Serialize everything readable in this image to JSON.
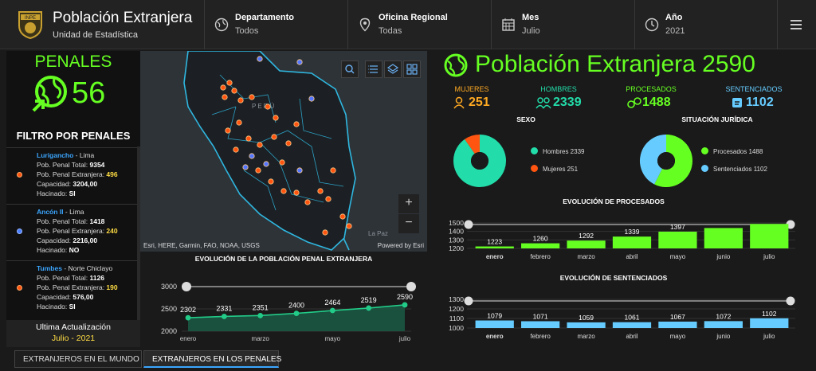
{
  "header": {
    "title": "Población Extranjera",
    "subtitle": "Unidad de Estadística",
    "logo_text": "INPE",
    "filters": [
      {
        "label": "Departamento",
        "value": "Todos",
        "icon": "globe-icon"
      },
      {
        "label": "Oficina Regional",
        "value": "Todas",
        "icon": "location-pin-icon"
      },
      {
        "label": "Mes",
        "value": "Julio",
        "icon": "calendar-icon"
      },
      {
        "label": "Año",
        "value": "2021",
        "icon": "clock-icon"
      }
    ],
    "menu_icon": "hamburger-menu-icon"
  },
  "left": {
    "penales_title": "PENALES",
    "penales_count": "56",
    "filtro_title": "FILTRO POR PENALES",
    "cards": [
      {
        "name": "Lurigancho",
        "region": " - Lima",
        "total_label": "Pob. Penal Total: ",
        "total": "9354",
        "ext_label": "Pob. Penal Extranjera: ",
        "ext": "496",
        "cap_label": "Capacidad: ",
        "cap": "3204,00",
        "hac_label": "Hacinado: ",
        "hac": "SI",
        "dot_color": "#ff5511"
      },
      {
        "name": "Ancón II",
        "region": " - Lima",
        "total_label": "Pob. Penal Total: ",
        "total": "1418",
        "ext_label": "Pob. Penal Extranjera: ",
        "ext": "240",
        "cap_label": "Capacidad: ",
        "cap": "2216,00",
        "hac_label": "Hacinado: ",
        "hac": "NO",
        "dot_color": "#4a7dff"
      },
      {
        "name": "Tumbes",
        "region": " - Norte Chiclayo",
        "total_label": "Pob. Penal Total: ",
        "total": "1126",
        "ext_label": "Pob. Penal Extranjera: ",
        "ext": "190",
        "cap_label": "Capacidad: ",
        "cap": "576,00",
        "hac_label": "Hacinado: ",
        "hac": "SI",
        "dot_color": "#ff5511"
      }
    ],
    "ultima_label": "Ultima Actualización",
    "ultima_value": "Julio - 2021"
  },
  "map": {
    "attribution": "Esri, HERE, Garmin, FAO, NOAA, USGS",
    "powered": "Powered by Esri",
    "country_label": "PERÚ",
    "city_label": "La Paz",
    "zoom_in": "+",
    "zoom_out": "−"
  },
  "evolucion_penal": {
    "title": "EVOLUCIÓN DE LA POBLACIÓN PENAL EXTRANJERA"
  },
  "right": {
    "title": "Población Extranjera 2590",
    "stats": [
      {
        "label": "MUJERES",
        "value": "251",
        "color": "#ffaa22",
        "icon": "woman-icon"
      },
      {
        "label": "HOMBRES",
        "value": "2339",
        "color": "#22ddaa",
        "icon": "men-group-icon"
      },
      {
        "label": "PROCESADOS",
        "value": "1488",
        "color": "#66ff22",
        "icon": "handcuffs-icon"
      },
      {
        "label": "SENTENCIADOS",
        "value": "1102",
        "color": "#66ccff",
        "icon": "gavel-icon"
      }
    ],
    "sexo_title": "SEXO",
    "situacion_title": "SITUACIÓN JURÍDICA",
    "sexo_legend": [
      {
        "label": "Hombres 2339",
        "color": "#22ddaa"
      },
      {
        "label": "Mujeres 251",
        "color": "#ff5511"
      }
    ],
    "situacion_legend": [
      {
        "label": "Procesados 1488",
        "color": "#66ff22"
      },
      {
        "label": "Sentenciados 1102",
        "color": "#66ccff"
      }
    ],
    "procesados_title": "EVOLUCIÓN DE PROCESADOS",
    "sentenciados_title": "EVOLUCIÓN DE SENTENCIADOS"
  },
  "tabs": [
    {
      "label": "EXTRANJEROS EN EL MUNDO",
      "active": false
    },
    {
      "label": "EXTRANJEROS EN LOS PENALES",
      "active": true
    }
  ],
  "chart_data": [
    {
      "type": "area",
      "title": "EVOLUCIÓN DE LA POBLACIÓN PENAL EXTRANJERA",
      "x_tick_labels": [
        "enero",
        "marzo",
        "mayo",
        "julio"
      ],
      "values": [
        2302,
        2331,
        2351,
        2400,
        2464,
        2519,
        2590
      ],
      "y_ticks": [
        2000,
        2500,
        3000
      ],
      "ylim": [
        2000,
        3000
      ],
      "color": "#22cc88"
    },
    {
      "type": "pie",
      "title": "SEXO",
      "labels": [
        "Hombres",
        "Mujeres"
      ],
      "values": [
        2339,
        251
      ],
      "colors": [
        "#22ddaa",
        "#ff5511"
      ]
    },
    {
      "type": "pie",
      "title": "SITUACIÓN JURÍDICA",
      "labels": [
        "Procesados",
        "Sentenciados"
      ],
      "values": [
        1488,
        1102
      ],
      "colors": [
        "#66ff22",
        "#66ccff"
      ]
    },
    {
      "type": "bar",
      "title": "EVOLUCIÓN DE PROCESADOS",
      "categories": [
        "enero",
        "febrero",
        "marzo",
        "abril",
        "mayo",
        "junio",
        "julio"
      ],
      "values": [
        1223,
        1260,
        1292,
        1339,
        1397,
        1440,
        1488
      ],
      "data_labels": [
        "1223",
        "1260",
        "1292",
        "1339",
        "1397",
        "",
        ""
      ],
      "y_ticks": [
        1200,
        1300,
        1400,
        1500
      ],
      "ylim": [
        1200,
        1500
      ],
      "color": "#66ff22"
    },
    {
      "type": "bar",
      "title": "EVOLUCIÓN DE SENTENCIADOS",
      "categories": [
        "enero",
        "febrero",
        "marzo",
        "abril",
        "mayo",
        "junio",
        "julio"
      ],
      "values": [
        1079,
        1071,
        1059,
        1061,
        1067,
        1072,
        1102
      ],
      "data_labels": [
        "1079",
        "1071",
        "1059",
        "1061",
        "1067",
        "1072",
        "1102"
      ],
      "y_ticks": [
        1000,
        1100,
        1200,
        1300
      ],
      "ylim": [
        1000,
        1300
      ],
      "color": "#66ccff"
    }
  ]
}
